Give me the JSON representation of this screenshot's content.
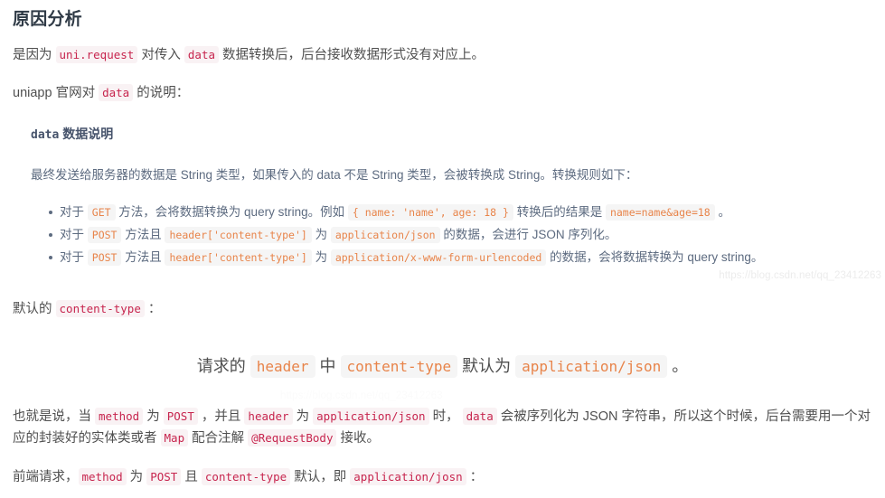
{
  "heading": "原因分析",
  "para1": {
    "seg1": "是因为 ",
    "code1": "uni.request",
    "seg2": " 对传入 ",
    "code2": "data",
    "seg3": " 数据转换后，后台接收数据形式没有对应上。"
  },
  "para2": {
    "seg1": "uniapp 官网对 ",
    "code1": "data",
    "seg2": " 的说明："
  },
  "quote": {
    "title_code": "data",
    "title_text": " 数据说明",
    "para": "最终发送给服务器的数据是 String 类型，如果传入的 data 不是 String 类型，会被转换成 String。转换规则如下：",
    "bullets": [
      {
        "s1": "对于 ",
        "c1": "GET",
        "s2": " 方法，会将数据转换为 query string。例如 ",
        "c2": "{ name: 'name', age: 18 }",
        "s3": " 转换后的结果是 ",
        "c3": "name=name&age=18",
        "s4": " 。"
      },
      {
        "s1": "对于 ",
        "c1": "POST",
        "s2": " 方法且 ",
        "c2": "header['content-type']",
        "s3": " 为 ",
        "c3": "application/json",
        "s4": " 的数据，会进行 JSON 序列化。"
      },
      {
        "s1": "对于 ",
        "c1": "POST",
        "s2": " 方法且 ",
        "c2": "header['content-type']",
        "s3": " 为 ",
        "c3": "application/x-www-form-urlencoded",
        "s4": " 的数据，会将数据转换为 query string。"
      }
    ]
  },
  "para3": {
    "seg1": "默认的 ",
    "code1": "content-type",
    "seg2": " ："
  },
  "center_line": {
    "seg1": "请求的 ",
    "code1": "header",
    "seg2": " 中 ",
    "code2": "content-type",
    "seg3": " 默认为 ",
    "code3": "application/json",
    "seg4": " 。"
  },
  "para4": {
    "seg1": "也就是说，当 ",
    "code1": "method",
    "seg2": " 为 ",
    "code2": "POST",
    "seg3": " ，并且 ",
    "code3": "header",
    "seg4": " 为 ",
    "code4": "application/json",
    "seg5": " 时， ",
    "code5": "data",
    "seg6": " 会被序列化为 JSON 字符串，所以这个时候，后台需要用一个对应的封装好的实体类或者 ",
    "code6": "Map",
    "seg7": " 配合注解 ",
    "code7": "@RequestBody",
    "seg8": " 接收。"
  },
  "para5": {
    "seg1": "前端请求，",
    "code1": "method",
    "seg2": " 为 ",
    "code2": "POST",
    "seg3": " 且 ",
    "code3": "content-type",
    "seg4": " 默认，即 ",
    "code4": "application/josn",
    "seg5": " ："
  },
  "watermark": "https://blog.csdn.net/qq_23412263",
  "watermark_faint": "https://blog.csdn.net/qq_23412263",
  "colors": {
    "code_crimson": "#c7254e",
    "code_crimson_bg": "#f9f2f4",
    "code_orange": "#e8844a",
    "code_orange_bg": "#f5f5f5",
    "body_text": "#4f4f4f",
    "quote_text": "#5d6b80",
    "heading": "#2f3a46"
  }
}
